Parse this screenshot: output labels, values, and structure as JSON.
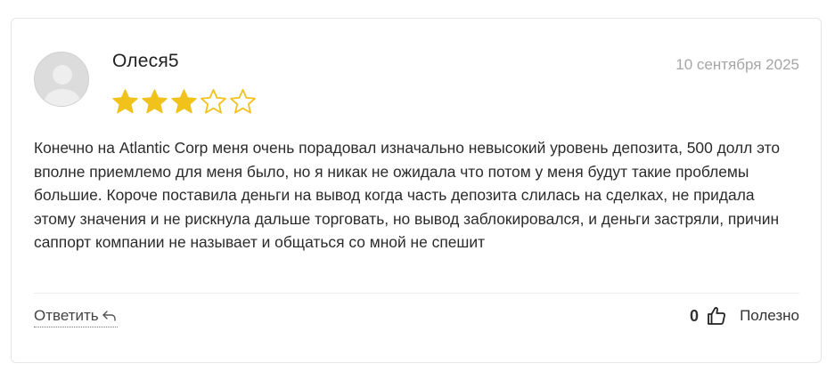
{
  "review": {
    "author": "Олеся5",
    "date": "10 сентября 2025",
    "rating": 3,
    "max_rating": 5,
    "text": "Конечно на Atlantic Corp меня очень порадовал изначально невысокий уровень депозита, 500 долл это вполне приемлемо для меня было, но я никак не ожидала что потом у меня будут такие проблемы большие. Короче поставила деньги на вывод когда часть депозита слилась на сделках, не придала этому значения и не рискнула дальше торговать, но вывод заблокировался, и деньги застряли, причин саппорт компании не называет и общаться со мной не спешит"
  },
  "actions": {
    "reply_label": "Ответить",
    "helpful_count": "0",
    "helpful_label": "Полезно"
  },
  "icons": {
    "avatar": "user-placeholder-icon",
    "star_filled": "star-filled-icon",
    "star_empty": "star-outline-icon",
    "reply": "reply-arrow-icon",
    "helpful": "thumbs-up-icon"
  },
  "colors": {
    "star": "#F0C21B",
    "text": "#2b2b2b",
    "date": "#a6a6a6",
    "avatar_bg": "#dcdcdc"
  }
}
